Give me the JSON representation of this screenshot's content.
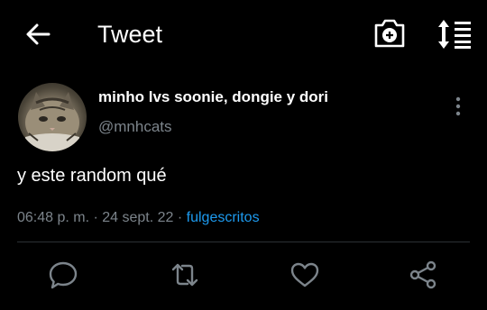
{
  "header": {
    "title": "Tweet",
    "icons": [
      "back-arrow-icon",
      "camera-add-icon",
      "sort-timeline-icon"
    ]
  },
  "tweet": {
    "author_name": "minho lvs soonie, dongie y dori",
    "author_handle": "@mnhcats",
    "text": "y este random qué",
    "time": "06:48 p. m.",
    "separator": " · ",
    "date": "24 sept. 22",
    "source": "fulgescritos"
  },
  "actions": {
    "icons": [
      "reply-icon",
      "retweet-icon",
      "like-icon",
      "share-icon"
    ]
  },
  "colors": {
    "background": "#000000",
    "text": "#ffffff",
    "secondary_text": "#7c848b",
    "link": "#1d9bf0",
    "divider": "#2b3035"
  }
}
